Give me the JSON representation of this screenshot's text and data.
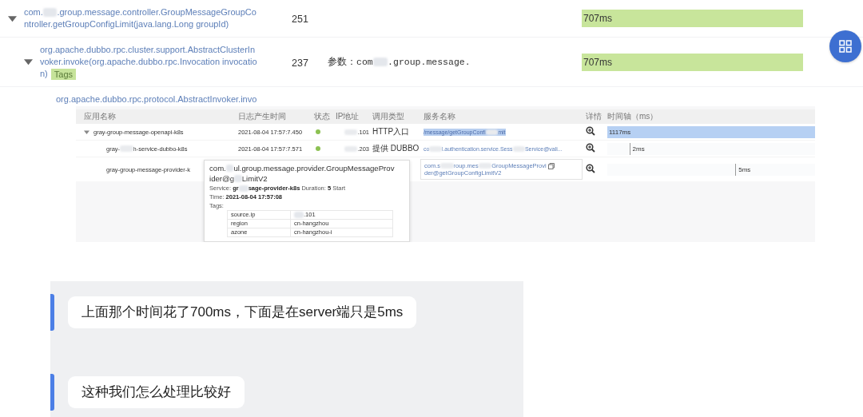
{
  "trace_tree": [
    {
      "method": [
        [
          "com.",
          {
            "redacted": true
          },
          ".group.message.controller.GroupMessageGroupCo"
        ],
        [
          "ntroller.getGroupConfigLimit(java.lang.Long groupId)"
        ]
      ],
      "expanded": true,
      "count": "251",
      "bar": {
        "label": "707ms",
        "level": 1
      },
      "children": [
        {
          "method": [
            [
              "org.apache.dubbo.rpc.cluster.support.AbstractClusterIn"
            ],
            [
              "voker.invoke(org.apache.dubbo.rpc.Invocation invocatio"
            ],
            [
              "n)"
            ]
          ],
          "tags": "Tags",
          "expanded": true,
          "count": "237",
          "params": [
            "参数：com",
            {
              "redacted": true
            },
            ".group.message."
          ],
          "bar": {
            "label": "707ms",
            "level": 1
          },
          "children": [
            {
              "method": [
                [
                  "org.apache.dubbo.rpc.protocol.AbstractInvoker.invo"
                ]
              ]
            }
          ]
        }
      ]
    }
  ],
  "span_table": {
    "columns": [
      "应用名称",
      "日志产生时间",
      "状态",
      "IP地址",
      "调用类型",
      "服务名称",
      "详情",
      "时间轴（ms）"
    ],
    "rows": [
      {
        "app": [
          "gray-group-message-openapi-k8s"
        ],
        "expanded": true,
        "time": "2021-08-04 17:57:7.450",
        "ok": true,
        "ip": [
          {
            "redacted": true
          },
          ".101"
        ],
        "type": "HTTP入口",
        "service": [
          [
            "/message/getGroupConfi",
            {
              "redacted": true
            },
            "mit"
          ]
        ],
        "selected": true,
        "hovered": false,
        "timeline": {
          "kind": "bar",
          "label": "1117ms",
          "level": 1
        }
      },
      {
        "app": [
          "gray-",
          {
            "redacted": true
          },
          "h-service-dubbo-k8s"
        ],
        "time": "2021-08-04 17:57:7.571",
        "ok": true,
        "ip": [
          {
            "redacted": true
          },
          ".203"
        ],
        "type": "提供 DUBBO",
        "service": [
          [
            "co",
            {
              "redacted": true
            },
            "l.authentication.service.Sess",
            {
              "redacted": true
            },
            "Service@vali..."
          ]
        ],
        "selected": false,
        "hovered": false,
        "timeline": {
          "kind": "tick",
          "label": "2ms",
          "level": 0.11
        }
      },
      {
        "app": [
          "gray-group-message-provider-k"
        ],
        "service": [
          [
            "com.s",
            {
              "redacted": true
            },
            "roup.mes",
            {
              "redacted": true
            },
            "GroupMessageProvi"
          ],
          [
            "der@getGroupConfigLimitV2"
          ]
        ],
        "selected": false,
        "hovered": true,
        "timeline": {
          "kind": "tick",
          "label": "5ms",
          "level": 0.62
        }
      }
    ],
    "tooltip": {
      "title": [
        [
          "com.",
          {
            "redacted": true
          },
          "ul.group.message.provider.GroupMessageProv"
        ],
        [
          "ider@g",
          {
            "redacted": true
          },
          "LimitV2"
        ]
      ],
      "service_label": "Service:",
      "service": [
        "gr",
        {
          "redacted": true
        },
        "sage-provider-k8s"
      ],
      "duration_label": "Duration:",
      "duration": "5",
      "start_label": "Start",
      "time_label": "Time:",
      "time": "2021-08-04 17:57:08",
      "tags_label": "Tags:",
      "tags": [
        {
          "key": "source.ip",
          "value": [
            {
              "redacted": true
            },
            ".101"
          ]
        },
        {
          "key": "region",
          "value": [
            "cn-hangzhou"
          ]
        },
        {
          "key": "azone",
          "value": [
            "cn-hangzhou-i"
          ]
        }
      ]
    }
  },
  "chat": {
    "messages": [
      {
        "text": "上面那个时间花了700ms，下面是在server端只是5ms"
      },
      {
        "text": "这种我们怎么处理比较好"
      }
    ]
  }
}
